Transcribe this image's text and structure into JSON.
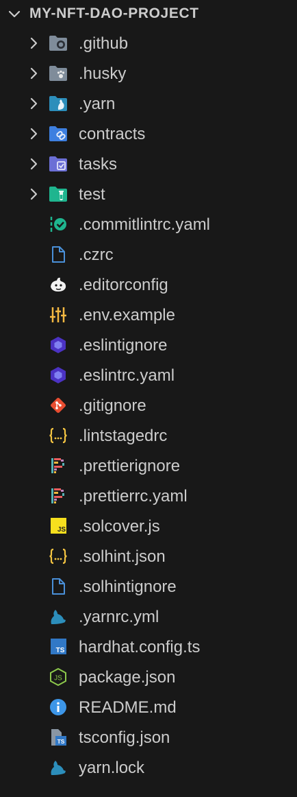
{
  "explorer": {
    "project_title": "MY-NFT-DAO-PROJECT",
    "folders": [
      {
        "label": ".github",
        "icon": "github-folder-icon"
      },
      {
        "label": ".husky",
        "icon": "husky-folder-icon"
      },
      {
        "label": ".yarn",
        "icon": "yarn-folder-icon"
      },
      {
        "label": "contracts",
        "icon": "contracts-folder-icon"
      },
      {
        "label": "tasks",
        "icon": "tasks-folder-icon"
      },
      {
        "label": "test",
        "icon": "test-folder-icon"
      }
    ],
    "files": [
      {
        "label": ".commitlintrc.yaml",
        "icon": "commitlint-icon"
      },
      {
        "label": ".czrc",
        "icon": "file-icon"
      },
      {
        "label": ".editorconfig",
        "icon": "editorconfig-icon"
      },
      {
        "label": ".env.example",
        "icon": "env-settings-icon"
      },
      {
        "label": ".eslintignore",
        "icon": "eslint-icon"
      },
      {
        "label": ".eslintrc.yaml",
        "icon": "eslint-icon"
      },
      {
        "label": ".gitignore",
        "icon": "git-icon"
      },
      {
        "label": ".lintstagedrc",
        "icon": "json-braces-icon"
      },
      {
        "label": ".prettierignore",
        "icon": "prettier-icon"
      },
      {
        "label": ".prettierrc.yaml",
        "icon": "prettier-icon"
      },
      {
        "label": ".solcover.js",
        "icon": "javascript-icon"
      },
      {
        "label": ".solhint.json",
        "icon": "json-braces-icon"
      },
      {
        "label": ".solhintignore",
        "icon": "file-icon"
      },
      {
        "label": ".yarnrc.yml",
        "icon": "yarn-icon"
      },
      {
        "label": "hardhat.config.ts",
        "icon": "typescript-icon"
      },
      {
        "label": "package.json",
        "icon": "nodejs-icon"
      },
      {
        "label": "README.md",
        "icon": "info-icon"
      },
      {
        "label": "tsconfig.json",
        "icon": "tsconfig-icon"
      },
      {
        "label": "yarn.lock",
        "icon": "yarn-icon"
      }
    ]
  },
  "colors": {
    "background": "#181818",
    "text": "#cccccc",
    "folder_blue": "#5b8ed6",
    "folder_grey": "#7f8c9a",
    "tasks_purple": "#6b6fd6",
    "test_teal": "#1fb58f",
    "eslint_purple": "#4b32c3",
    "git_orange": "#e84d31",
    "json_yellow": "#f5c542",
    "js_yellow": "#f7df1e",
    "ts_blue": "#3178c6",
    "node_green": "#8cc84b",
    "yarn_blue": "#2c8ebb"
  }
}
